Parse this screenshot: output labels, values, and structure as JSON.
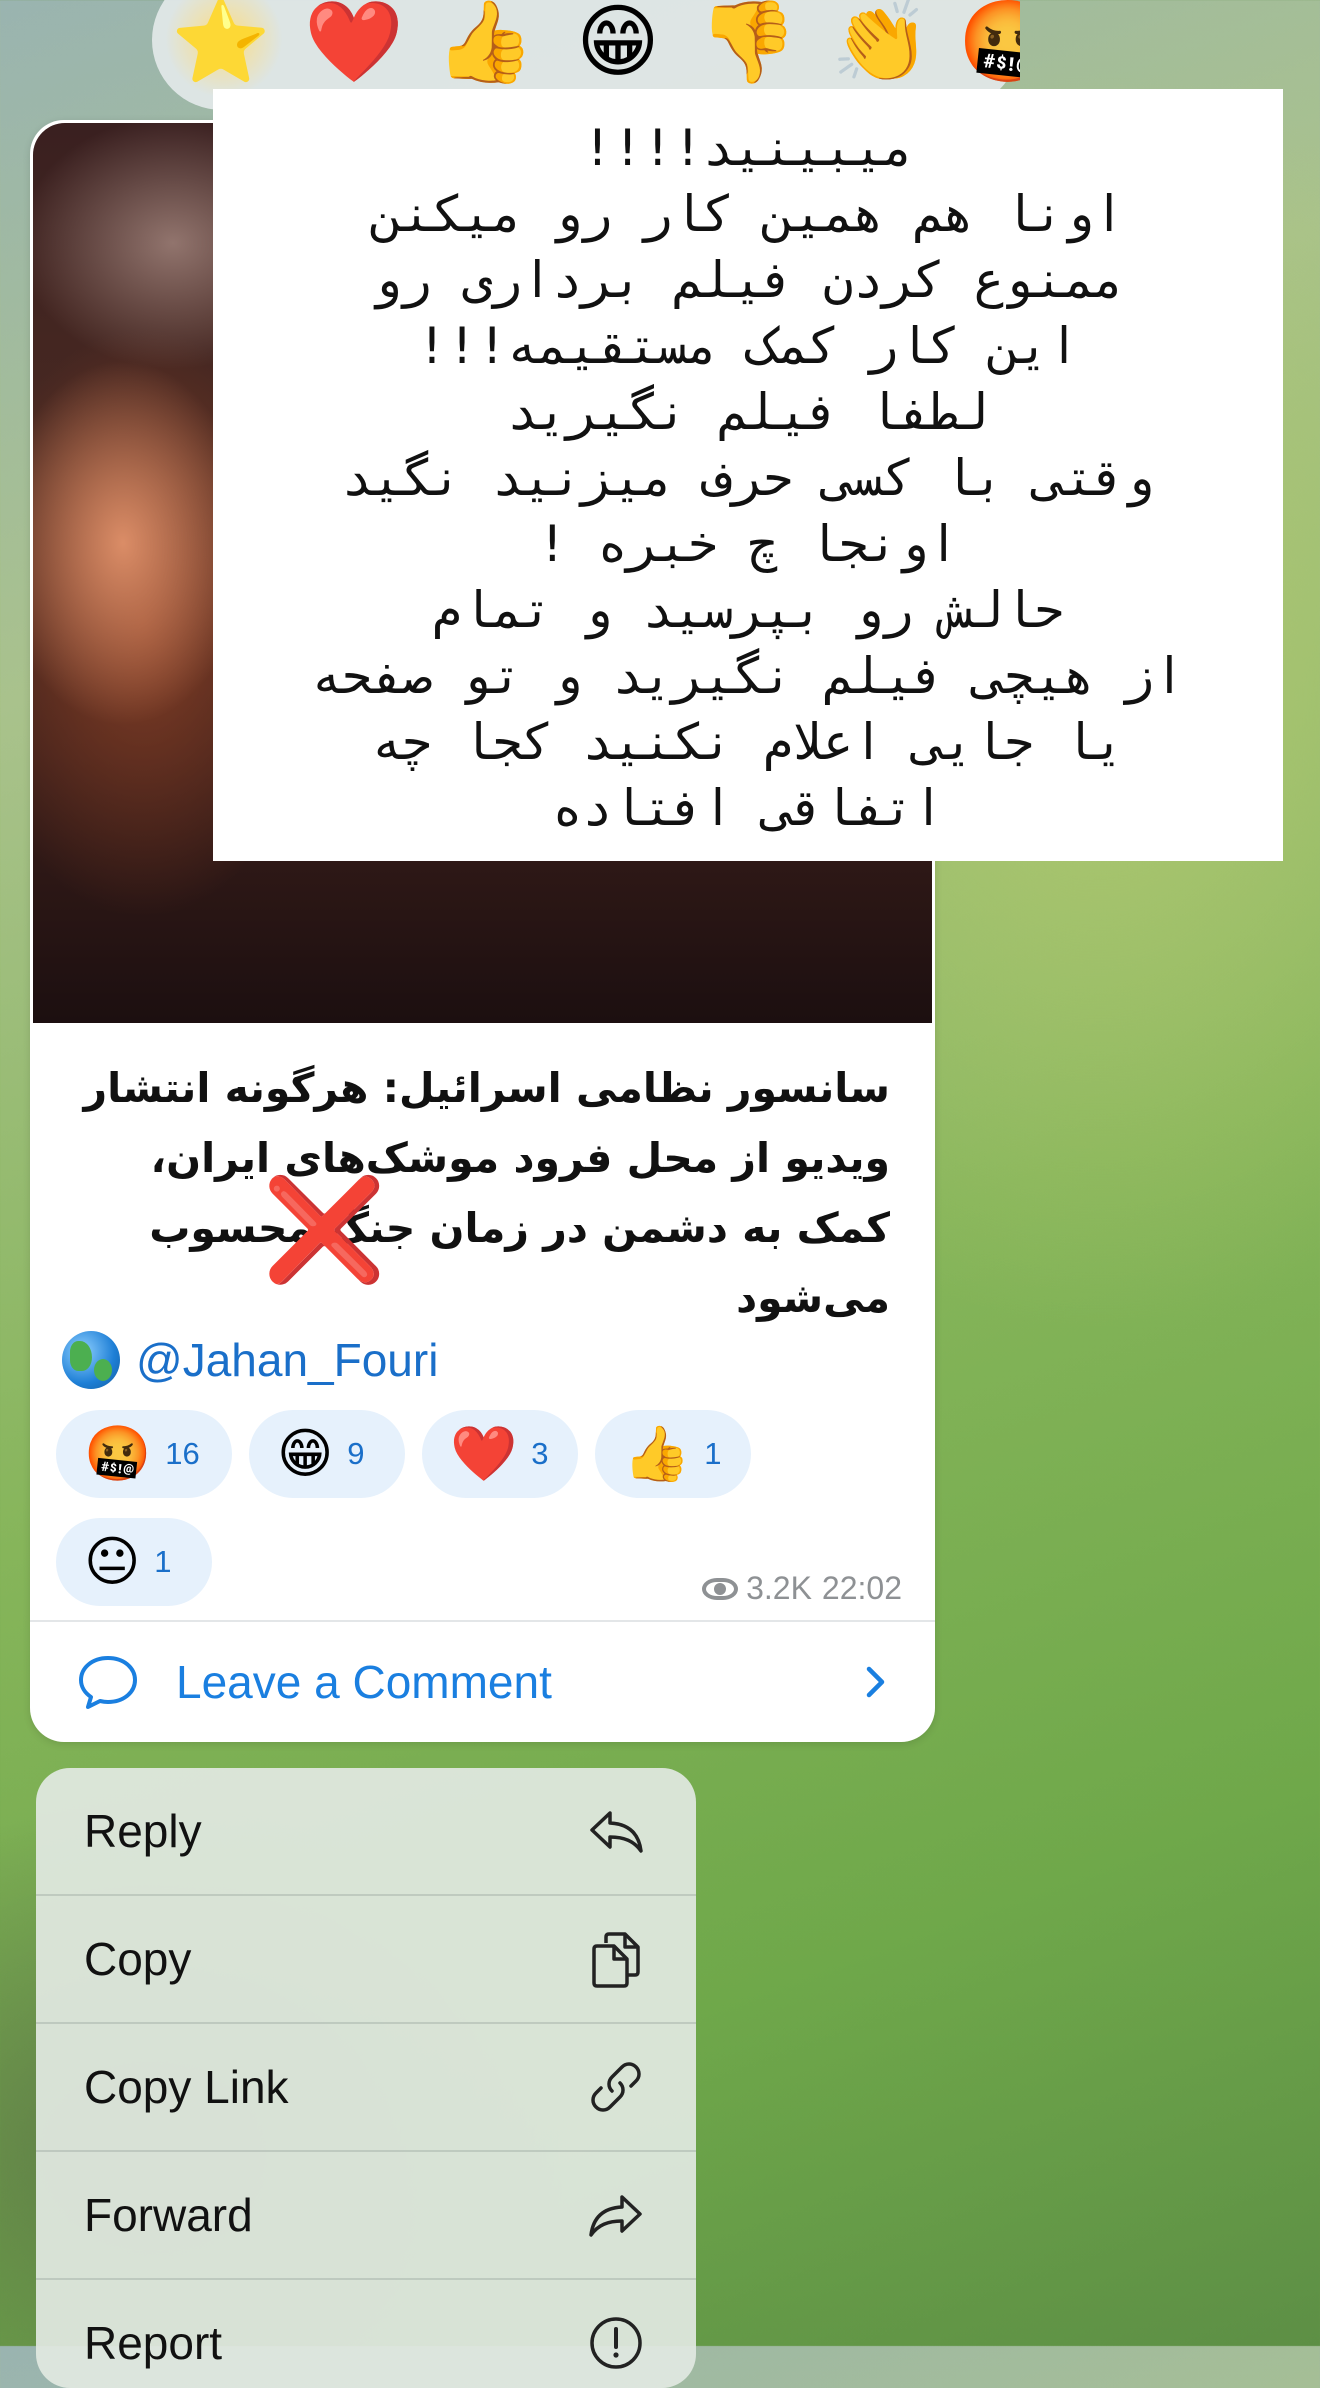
{
  "reaction_picker": {
    "emojis": [
      {
        "name": "star-emoji",
        "char": "⭐"
      },
      {
        "name": "heart-emoji",
        "char": "❤️"
      },
      {
        "name": "thumbs-up-emoji",
        "char": "👍"
      },
      {
        "name": "grinning-emoji",
        "char": "😁"
      },
      {
        "name": "thumbs-down-emoji",
        "char": "👎"
      },
      {
        "name": "clapping-emoji",
        "char": "👏"
      },
      {
        "name": "cursing-face-emoji",
        "char": "🤬"
      }
    ]
  },
  "message": {
    "overlay_lines": [
      "میبینید!!!!",
      "اونا هم همین کار رو میکنن",
      "ممنوع کردن فیلم برداری رو",
      "این کار کمک مستقیمه!!!",
      "لطفا فیلم نگیرید",
      "وقتی با کسی حرف میزنید نگید",
      "اونجا چ خبره !",
      "حالش رو بپرسید و تمام",
      "از هیچی فیلم نگیرید و تو صفحه",
      "یا جایی اعلام نکنید کجا چه",
      "اتفاقی افتاده"
    ],
    "caption": "سانسور نظامی اسرائیل: هرگونه انتشار ویدیو از محل فرود موشک‌های ایران، کمک به دشمن در زمان جنگ محسوب می‌شود",
    "cross_mark": "❌",
    "channel_link": "@Jahan_Fouri",
    "reactions": [
      {
        "emoji": "🤬",
        "count": "16"
      },
      {
        "emoji": "😁",
        "count": "9"
      },
      {
        "emoji": "❤️",
        "count": "3"
      },
      {
        "emoji": "👍",
        "count": "1"
      },
      {
        "emoji": "😐",
        "count": "1"
      }
    ],
    "views": "3.2K",
    "time": "22:02",
    "comment_label": "Leave a Comment"
  },
  "context_menu": {
    "items": [
      {
        "label": "Reply",
        "icon": "reply-icon"
      },
      {
        "label": "Copy",
        "icon": "copy-icon"
      },
      {
        "label": "Copy Link",
        "icon": "link-icon"
      },
      {
        "label": "Forward",
        "icon": "forward-icon"
      },
      {
        "label": "Report",
        "icon": "report-icon"
      }
    ]
  },
  "colors": {
    "accent": "#1a7fe0",
    "link": "#1a6fc9",
    "reaction_pill": "#e6f1fc",
    "cross": "#e0202a"
  }
}
